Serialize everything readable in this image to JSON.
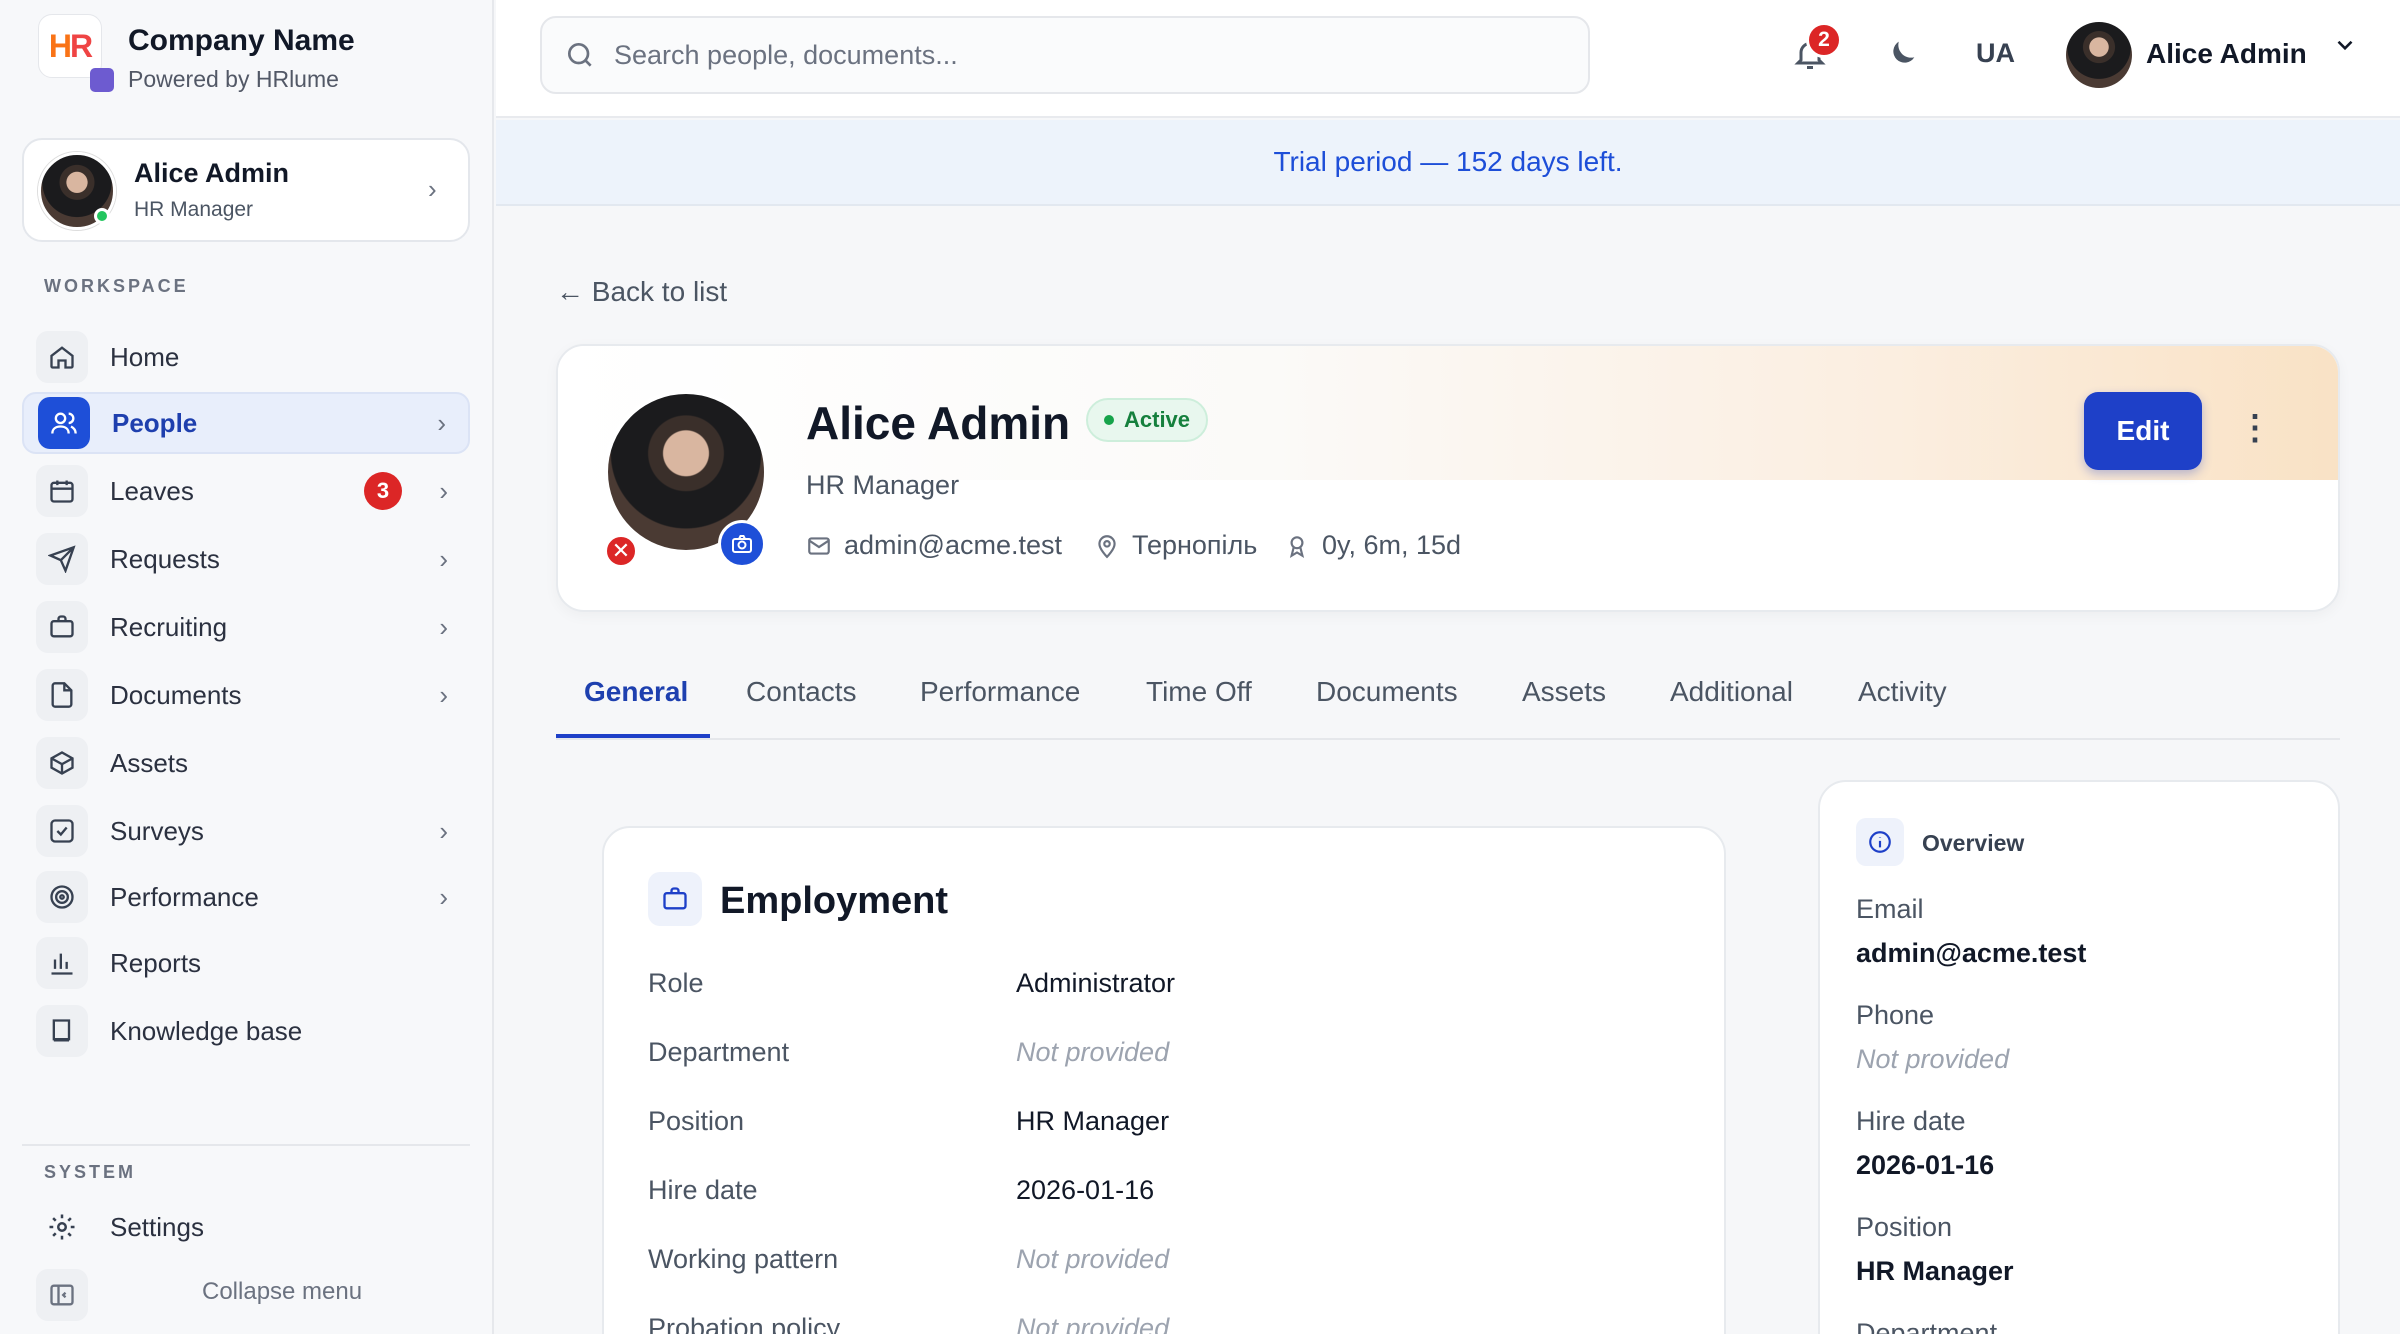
{
  "brand": {
    "logo_text_h": "H",
    "logo_text_r": "R",
    "company": "Company Name",
    "powered": "Powered by HRlume"
  },
  "sidebar_user": {
    "name": "Alice Admin",
    "role": "HR Manager"
  },
  "sidebar": {
    "workspace_title": "WORKSPACE",
    "items": [
      {
        "label": "Home",
        "icon": "home-icon",
        "active": false
      },
      {
        "label": "People",
        "icon": "users-icon",
        "active": true
      },
      {
        "label": "Leaves",
        "icon": "calendar-icon",
        "badge": "3"
      },
      {
        "label": "Requests",
        "icon": "send-icon"
      },
      {
        "label": "Recruiting",
        "icon": "briefcase-icon"
      },
      {
        "label": "Documents",
        "icon": "file-icon"
      },
      {
        "label": "Assets",
        "icon": "box-icon"
      },
      {
        "label": "Surveys",
        "icon": "checkbox-icon"
      },
      {
        "label": "Performance",
        "icon": "target-icon"
      },
      {
        "label": "Reports",
        "icon": "bar-chart-icon"
      },
      {
        "label": "Knowledge base",
        "icon": "book-icon"
      }
    ],
    "system_title": "SYSTEM",
    "settings_label": "Settings",
    "collapse_label": "Collapse menu"
  },
  "header": {
    "search_placeholder": "Search people, documents...",
    "notifications_count": "2",
    "language": "UA",
    "user_name": "Alice Admin"
  },
  "trial_banner": "Trial period — 152 days left.",
  "back_link": "← Back to list",
  "profile": {
    "name": "Alice Admin",
    "status": "Active",
    "role": "HR Manager",
    "email": "admin@acme.test",
    "location": "Тернопіль",
    "tenure": "0y, 6m, 15d",
    "edit_label": "Edit",
    "more_label": "⋮"
  },
  "tabs": [
    "General",
    "Contacts",
    "Performance",
    "Time Off",
    "Documents",
    "Assets",
    "Additional",
    "Activity"
  ],
  "employment": {
    "title": "Employment",
    "rows": [
      {
        "label": "Role",
        "value": "Administrator"
      },
      {
        "label": "Department",
        "value": "Not provided"
      },
      {
        "label": "Position",
        "value": "HR Manager"
      },
      {
        "label": "Hire date",
        "value": "2026-01-16"
      },
      {
        "label": "Working pattern",
        "value": "Not provided"
      },
      {
        "label": "Probation policy",
        "value": "Not provided"
      }
    ]
  },
  "overview": {
    "title": "Overview",
    "fields": [
      {
        "label": "Email",
        "value": "admin@acme.test"
      },
      {
        "label": "Phone",
        "value": "Not provided"
      },
      {
        "label": "Hire date",
        "value": "2026-01-16"
      },
      {
        "label": "Position",
        "value": "HR Manager"
      },
      {
        "label": "Department",
        "value": ""
      }
    ]
  },
  "colors": {
    "accent": "#1e40c8",
    "badge": "#dc2626",
    "active_green": "#15803d"
  }
}
